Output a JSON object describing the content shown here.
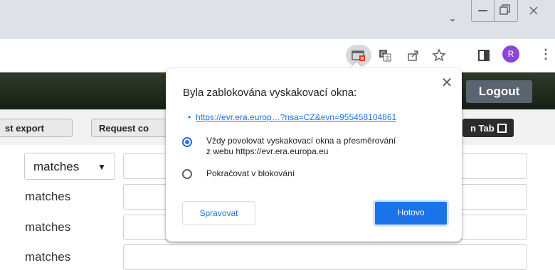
{
  "browser": {
    "tab_strip_chevron": "⌄",
    "window_controls": {
      "minimize": "minimize-icon",
      "restore": "restore-icon",
      "close": "close-icon"
    },
    "toolbar": {
      "avatar_letter": "R",
      "avatar_color": "#8e44d6",
      "icons": [
        "popup-blocked-icon",
        "translate-icon",
        "share-icon",
        "bookmark-star-icon",
        "side-panel-icon",
        "menu-icon"
      ]
    }
  },
  "page": {
    "logout_label": "Logout",
    "buttons": {
      "export": "st export",
      "request": "Request co",
      "new_tab": "n Tab"
    },
    "filters": [
      {
        "label": "matches",
        "is_select": true
      },
      {
        "label": "matches"
      },
      {
        "label": "matches"
      },
      {
        "label": "matches"
      }
    ]
  },
  "popup_bubble": {
    "title": "Byla zablokována vyskakovací okna:",
    "blocked_link": "https://evr.era.europ…?nsa=CZ&evn=955458104861",
    "option_allow_line1": "Vždy povolovat vyskakovací okna a přesměrování",
    "option_allow_line2": "z webu https://evr.era.europa.eu",
    "option_block": "Pokračovat v blokování",
    "selected_option": "allow",
    "manage_label": "Spravovat",
    "done_label": "Hotovo",
    "accent_color": "#1a73e8"
  }
}
